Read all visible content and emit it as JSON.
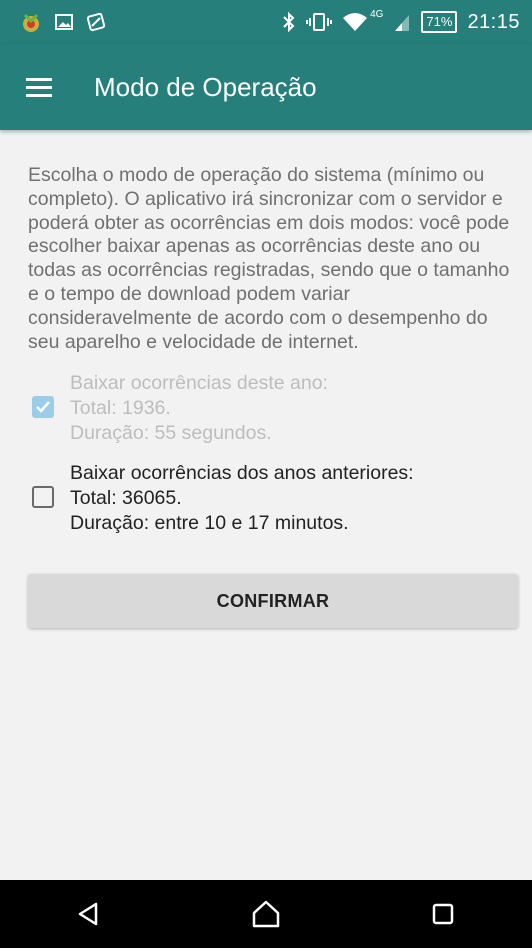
{
  "status_bar": {
    "time": "21:15",
    "battery": "71%",
    "network": "4G",
    "icons": [
      "notification-app-icon",
      "gallery-icon",
      "edit-app-icon",
      "bluetooth-icon",
      "vibrate-icon",
      "wifi-icon",
      "signal-icon",
      "battery-icon"
    ]
  },
  "toolbar": {
    "title": "Modo de Operação",
    "menu_icon": "hamburger-menu-icon"
  },
  "main": {
    "description": "Escolha o modo de operação do sistema (mínimo ou completo). O aplicativo irá sincronizar com o servidor e poderá obter as ocorrências em dois modos: você pode escolher baixar apenas as ocorrências deste ano ou todas as ocorrências registradas, sendo que o tamanho e o tempo de download podem variar consideravelmente de acordo com o desempenho do seu aparelho e velocidade de internet.",
    "options": [
      {
        "line1": "Baixar ocorrências deste ano:",
        "line2": "Total: 1936.",
        "line3": "Duração: 55 segundos.",
        "checked": true,
        "enabled": false
      },
      {
        "line1": "Baixar ocorrências dos anos anteriores:",
        "line2": "Total: 36065.",
        "line3": "Duração: entre 10 e 17 minutos.",
        "checked": false,
        "enabled": true
      }
    ],
    "confirm_label": "CONFIRMAR"
  },
  "nav_bar": {
    "buttons": [
      "back-icon",
      "home-icon",
      "recents-icon"
    ]
  },
  "colors": {
    "primary": "#267f7a",
    "checkbox_checked_disabled": "#9ccde8",
    "button_bg": "#d9d9d9",
    "text_secondary": "#707070"
  }
}
